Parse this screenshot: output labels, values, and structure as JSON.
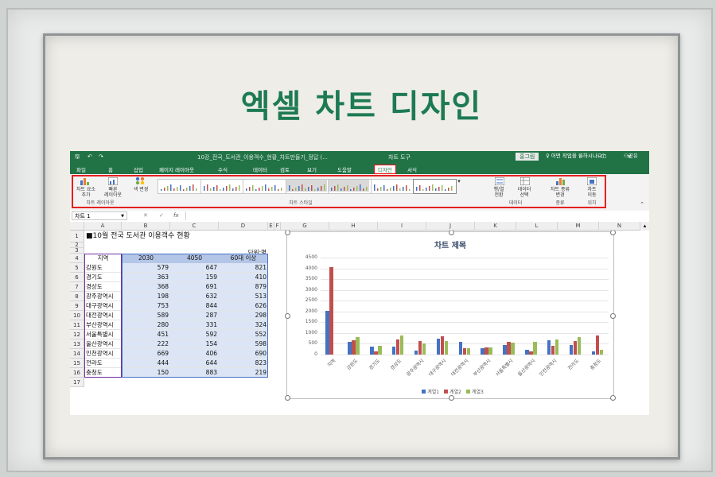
{
  "slide_title": "엑셀 차트 디자인",
  "window": {
    "title": "10강_전국_도서관_이용객수_현황_차트만들기_정답 (...",
    "chart_tools": "차트 도구",
    "user": "홍그림",
    "qa_icons": [
      "save-icon",
      "undo-icon",
      "redo-icon"
    ]
  },
  "tabs": [
    "파일",
    "홈",
    "삽입",
    "페이지 레이아웃",
    "수식",
    "데이터",
    "검토",
    "보기",
    "도움말",
    "디자인",
    "서식"
  ],
  "active_tab": "디자인",
  "tell_me": "어떤 작업을 원하시나요?",
  "share": "공유",
  "ribbon": {
    "add_element": "차트 요소\n추가",
    "quick_layout": "빠른\n레이아웃",
    "change_colors": "색 변경",
    "group_layout": "차트 레이아웃",
    "group_styles": "차트 스타일",
    "switch_row_col": "행/열\n전환",
    "select_data": "데이터\n선택",
    "group_data": "데이터",
    "change_type": "차트 종류\n변경",
    "group_type": "종류",
    "move_chart": "차트\n이동",
    "group_location": "위치"
  },
  "formula_bar": {
    "name_box": "차트 1",
    "fx": "fx",
    "cancel": "✕",
    "confirm": "✓"
  },
  "sheet": {
    "col_headers": [
      "A",
      "B",
      "C",
      "D",
      "E",
      "F",
      "G",
      "H",
      "I",
      "J",
      "K",
      "L",
      "M",
      "N"
    ],
    "title": "■10월 전국 도서관 이용객수 현황",
    "unit": "단위:명",
    "headers": [
      "지역",
      "2030",
      "4050",
      "60대 이상"
    ],
    "rows": [
      [
        "강원도",
        "579",
        "647",
        "821"
      ],
      [
        "경기도",
        "363",
        "159",
        "410"
      ],
      [
        "경상도",
        "368",
        "691",
        "879"
      ],
      [
        "광주광역시",
        "198",
        "632",
        "513"
      ],
      [
        "대구광역시",
        "753",
        "844",
        "626"
      ],
      [
        "대전광역시",
        "589",
        "287",
        "298"
      ],
      [
        "부산광역시",
        "280",
        "331",
        "324"
      ],
      [
        "서울특별시",
        "451",
        "592",
        "552"
      ],
      [
        "울산광역시",
        "222",
        "154",
        "598"
      ],
      [
        "인천광역시",
        "669",
        "406",
        "690"
      ],
      [
        "전라도",
        "444",
        "644",
        "823"
      ],
      [
        "충청도",
        "150",
        "883",
        "219"
      ]
    ]
  },
  "chart_data": {
    "type": "bar",
    "title": "차트 제목",
    "categories": [
      "지역",
      "강원도",
      "경기도",
      "경상도",
      "광주광역시",
      "대구광역시",
      "대전광역시",
      "부산광역시",
      "서울특별시",
      "울산광역시",
      "인천광역시",
      "전라도",
      "충청도"
    ],
    "series": [
      {
        "name": "계열1",
        "color": "#4472c4",
        "values": [
          2030,
          579,
          363,
          368,
          198,
          753,
          589,
          280,
          451,
          222,
          669,
          444,
          150
        ]
      },
      {
        "name": "계열2",
        "color": "#c0504d",
        "values": [
          4050,
          647,
          159,
          691,
          632,
          844,
          287,
          331,
          592,
          154,
          406,
          644,
          883
        ]
      },
      {
        "name": "계열3",
        "color": "#9bbb59",
        "values": [
          0,
          821,
          410,
          879,
          513,
          626,
          298,
          324,
          552,
          598,
          690,
          823,
          219
        ]
      }
    ],
    "ylim": [
      0,
      4500
    ],
    "yticks": [
      "0",
      "500",
      "1000",
      "1500",
      "2000",
      "2500",
      "3000",
      "3500",
      "4000",
      "4500"
    ],
    "grid": true,
    "legend": "bottom"
  },
  "colors": {
    "excel_green": "#217346",
    "title_green": "#1d7a52",
    "highlight_red": "#e42020",
    "header_blue": "#b4c6e7"
  }
}
